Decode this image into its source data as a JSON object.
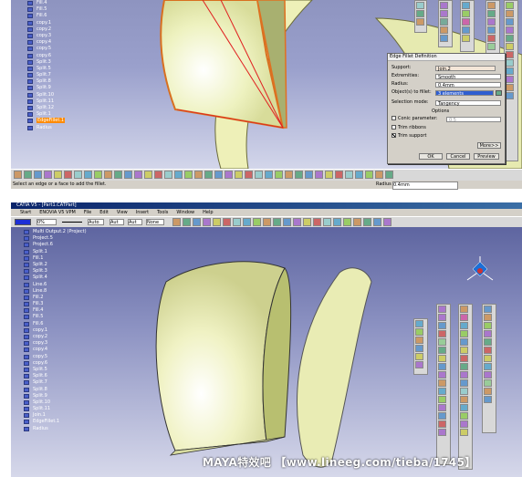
{
  "top": {
    "tree_items": [
      "Fill.4",
      "Fill.5",
      "Fill.6",
      "copy.1",
      "copy.2",
      "copy.3",
      "copy.4",
      "copy.5",
      "copy.6",
      "Split.3",
      "Split.5",
      "Split.7",
      "Split.8",
      "Split.9",
      "Split.10",
      "Split.11",
      "Split.12",
      "Split.1",
      "Radius"
    ],
    "tree_highlight": "EdgeFillet.1",
    "status_text": "Select an edge or a face to add the fillet.",
    "status_radius_label": "Radius",
    "status_radius_value": "0.4mm",
    "dialog": {
      "title": "Edge Fillet Definition",
      "support_label": "Support:",
      "support_value": "Join.2",
      "extremities_label": "Extremities:",
      "extremities_value": "Smooth",
      "radius_label": "Radius:",
      "radius_value": "0.4mm",
      "objects_label": "Object(s) to fillet:",
      "objects_value": "3 elements",
      "selection_mode_label": "Selection mode:",
      "selection_mode_value": "Tangency",
      "options_label": "Options",
      "conic_label": "Conic parameter:",
      "conic_value": "0.5",
      "trim_ribbons_label": "Trim ribbons",
      "trim_support_label": "Trim support",
      "more_label": "More>>",
      "ok_label": "OK",
      "cancel_label": "Cancel",
      "preview_label": "Preview"
    }
  },
  "bottom": {
    "window_title": "CATIA V5 - [Part1.CATPart]",
    "menu": [
      "Start",
      "ENOVIA V5 VPM",
      "File",
      "Edit",
      "View",
      "Insert",
      "Tools",
      "Window",
      "Help"
    ],
    "tree_items": [
      "Multi Output.2 (Project)",
      "Project.5",
      "Project.6",
      "Split.1",
      "Fill.1",
      "Split.2",
      "Split.3",
      "Split.4",
      "Line.6",
      "Line.8",
      "Fill.2",
      "Fill.3",
      "Fill.4",
      "Fill.5",
      "Fill.6",
      "copy.1",
      "copy.2",
      "copy.3",
      "copy.4",
      "copy.5",
      "copy.6",
      "Split.5",
      "Split.6",
      "Split.7",
      "Split.8",
      "Split.9",
      "Split.10",
      "Split.11",
      "Join.1",
      "EdgeFillet.1",
      "Radius"
    ],
    "toolbar_values": [
      "0%",
      "Auto",
      "Aut",
      "Aut",
      "None"
    ]
  },
  "watermark": "MAYA特效吧  【www.lineeg.com/tieba/1745】",
  "colors": {
    "viewport": "#9aa0cc",
    "surface": "#e8ecb0",
    "highlight": "#ff8a00"
  }
}
